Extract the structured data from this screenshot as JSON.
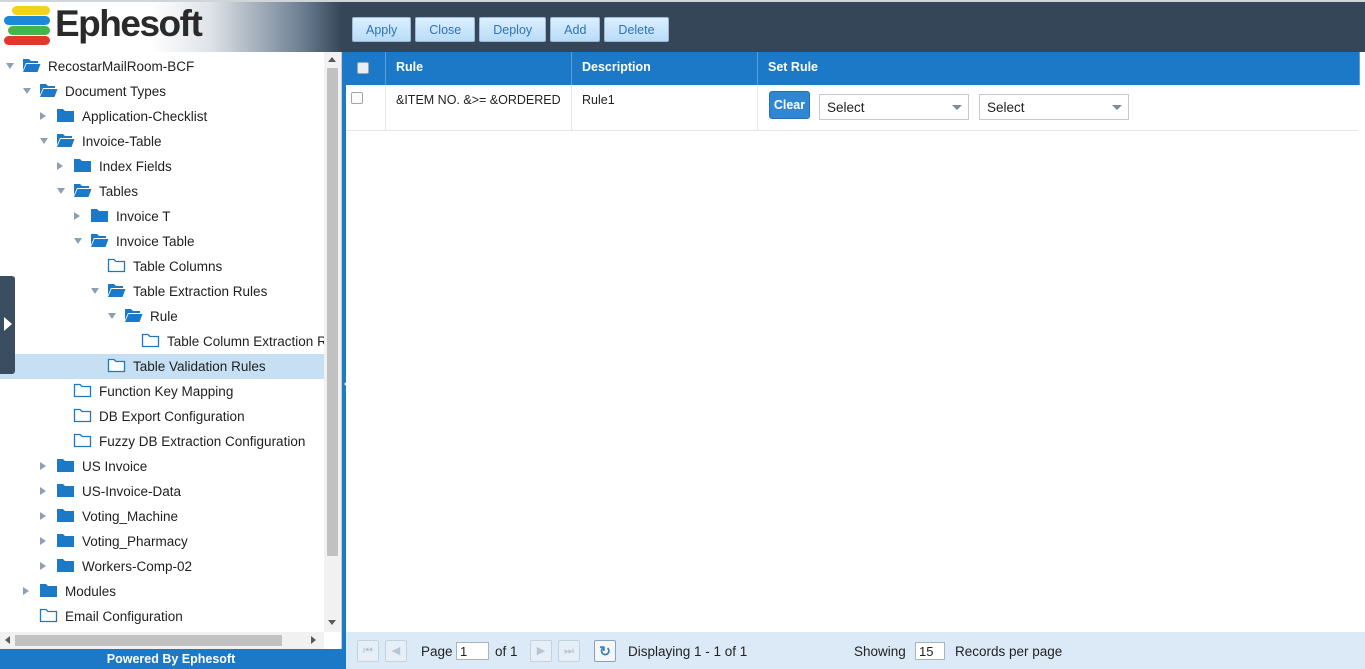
{
  "header": {
    "logo_text": "Ephesoft",
    "toolbar": [
      {
        "label": "Apply"
      },
      {
        "label": "Close"
      },
      {
        "label": "Deploy"
      },
      {
        "label": "Add"
      },
      {
        "label": "Delete"
      }
    ]
  },
  "tree": {
    "items": [
      {
        "label": "RecostarMailRoom-BCF",
        "level": 0,
        "expander": "down",
        "folder": "open-filled"
      },
      {
        "label": "Document Types",
        "level": 1,
        "expander": "down",
        "folder": "open-filled"
      },
      {
        "label": "Application-Checklist",
        "level": 2,
        "expander": "right",
        "folder": "closed-filled"
      },
      {
        "label": "Invoice-Table",
        "level": 2,
        "expander": "down",
        "folder": "open-filled"
      },
      {
        "label": "Index Fields",
        "level": 3,
        "expander": "right",
        "folder": "closed-filled"
      },
      {
        "label": "Tables",
        "level": 3,
        "expander": "down",
        "folder": "open-filled"
      },
      {
        "label": "Invoice T",
        "level": 4,
        "expander": "right",
        "folder": "closed-filled"
      },
      {
        "label": "Invoice Table",
        "level": 4,
        "expander": "down",
        "folder": "open-filled"
      },
      {
        "label": "Table Columns",
        "level": 5,
        "expander": "none",
        "folder": "outline"
      },
      {
        "label": "Table Extraction Rules",
        "level": 5,
        "expander": "down",
        "folder": "open-filled"
      },
      {
        "label": "Rule",
        "level": 6,
        "expander": "down",
        "folder": "open-filled"
      },
      {
        "label": "Table Column Extraction R",
        "level": 7,
        "expander": "none",
        "folder": "outline"
      },
      {
        "label": "Table Validation Rules",
        "level": 5,
        "expander": "none",
        "folder": "outline",
        "selected": true
      },
      {
        "label": "Function Key Mapping",
        "level": 3,
        "expander": "none",
        "folder": "outline"
      },
      {
        "label": "DB Export Configuration",
        "level": 3,
        "expander": "none",
        "folder": "outline"
      },
      {
        "label": "Fuzzy DB Extraction Configuration",
        "level": 3,
        "expander": "none",
        "folder": "outline"
      },
      {
        "label": "US Invoice",
        "level": 2,
        "expander": "right",
        "folder": "closed-filled"
      },
      {
        "label": "US-Invoice-Data",
        "level": 2,
        "expander": "right",
        "folder": "closed-filled"
      },
      {
        "label": "Voting_Machine",
        "level": 2,
        "expander": "right",
        "folder": "closed-filled"
      },
      {
        "label": "Voting_Pharmacy",
        "level": 2,
        "expander": "right",
        "folder": "closed-filled"
      },
      {
        "label": "Workers-Comp-02",
        "level": 2,
        "expander": "right",
        "folder": "closed-filled"
      },
      {
        "label": "Modules",
        "level": 1,
        "expander": "right",
        "folder": "closed-filled"
      },
      {
        "label": "Email Configuration",
        "level": 1,
        "expander": "none",
        "folder": "outline"
      }
    ],
    "footer": "Powered By Ephesoft"
  },
  "grid": {
    "columns": [
      {
        "label": ""
      },
      {
        "label": "Rule"
      },
      {
        "label": "Description"
      },
      {
        "label": "Set Rule"
      }
    ],
    "rows": [
      {
        "rule": "&ITEM NO. &>= &ORDERED",
        "description": "Rule1",
        "clear_label": "Clear",
        "select1": "Select",
        "select2": "Select"
      }
    ]
  },
  "pager": {
    "page_label": "Page",
    "page_value": "1",
    "of_label": "of 1",
    "displaying": "Displaying 1 - 1 of 1",
    "showing_label": "Showing",
    "per_page_value": "15",
    "records_label": "Records per page"
  },
  "colors": {
    "header_bg": "#354659",
    "accent_blue": "#1b79c8",
    "folder_blue": "#1b79c8",
    "selected_row": "#c6dff2",
    "pager_bg": "#dbeaf6"
  }
}
